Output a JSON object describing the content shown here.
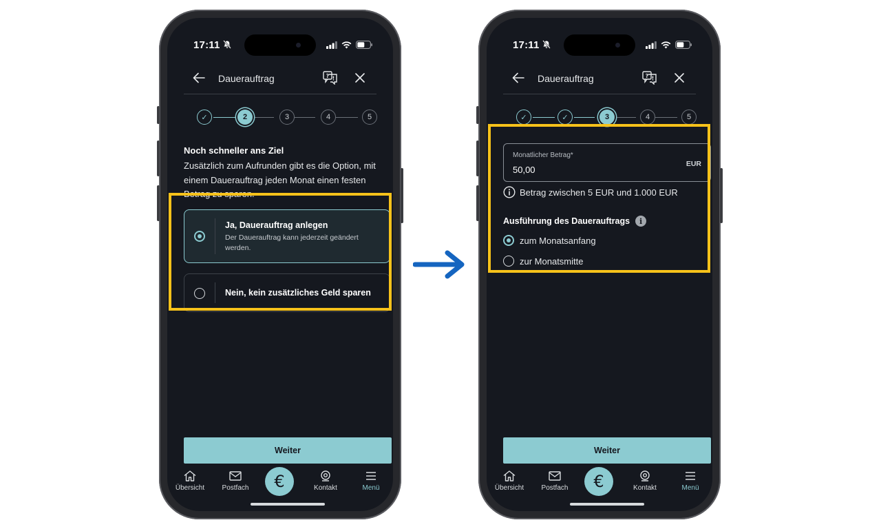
{
  "colors": {
    "accent": "#8ccbd1",
    "highlight": "#f7c21a",
    "arrow": "#1565c0",
    "screen_bg": "#15181f"
  },
  "status": {
    "time": "17:11"
  },
  "header": {
    "title": "Dauerauftrag",
    "back_icon": "arrow-left-icon",
    "help_icon": "chat-question-icon",
    "close_icon": "close-icon"
  },
  "left": {
    "steps": [
      "✓",
      "2",
      "3",
      "4",
      "5"
    ],
    "intro_title": "Noch schneller ans Ziel",
    "intro_text": "Zusätzlich zum Aufrunden gibt es die Option, mit einem Dauerauftrag jeden Monat einen festen Betrag zu sparen.",
    "options": [
      {
        "title": "Ja, Dauerauftrag anlegen",
        "subtitle": "Der Dauerauftrag kann jederzeit geändert werden.",
        "selected": true
      },
      {
        "title": "Nein, kein zusätzliches Geld sparen",
        "selected": false
      }
    ]
  },
  "right": {
    "steps": [
      "✓",
      "✓",
      "3",
      "4",
      "5"
    ],
    "amount": {
      "label": "Monatlicher Betrag*",
      "value": "50,00",
      "unit": "EUR"
    },
    "hint": "Betrag zwischen 5 EUR und 1.000 EUR",
    "execution_title": "Ausführung des Dauerauftrags",
    "execution_options": [
      {
        "label": "zum Monatsanfang",
        "selected": true
      },
      {
        "label": "zur Monatsmitte",
        "selected": false
      }
    ]
  },
  "footer": {
    "next_label": "Weiter"
  },
  "nav": {
    "items": [
      {
        "label": "Übersicht",
        "icon": "home-icon"
      },
      {
        "label": "Postfach",
        "icon": "mail-icon"
      },
      {
        "label": "Kontakt",
        "icon": "contact-icon"
      },
      {
        "label": "Menü",
        "icon": "menu-icon",
        "active": true
      }
    ],
    "center_symbol": "€"
  }
}
